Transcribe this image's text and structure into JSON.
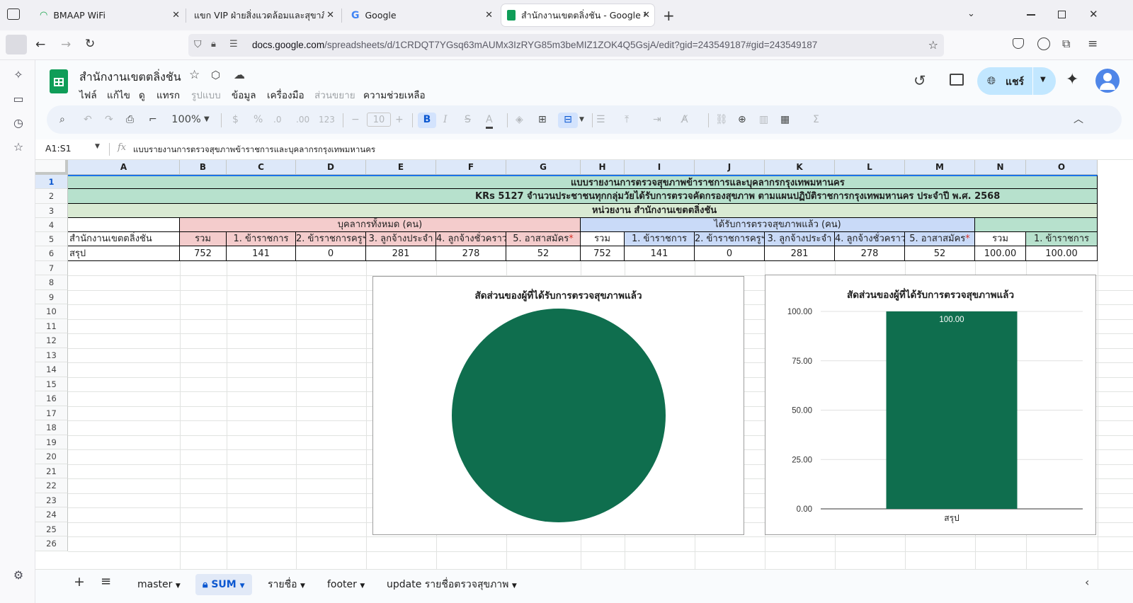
{
  "browser": {
    "tabs": [
      {
        "label": "BMAAP WiFi",
        "icon": "wifi-icon"
      },
      {
        "label": "แขก VIP ฝ่ายสิ่งแวดล้อมและสุขาภิบาล",
        "icon": "none"
      },
      {
        "label": "Google",
        "icon": "google-icon"
      },
      {
        "label": "สำนักงานเขตตลิ่งชัน - Google ชีต",
        "icon": "sheets-icon",
        "active": true
      }
    ],
    "url_domain": "docs.google.com",
    "url_path": "/spreadsheets/d/1CRDQT7YGsq63mAUMx3IzRYG85m3beMIZ1ZOK4Q5GsjA/edit?gid=243549187#gid=243549187"
  },
  "sheets": {
    "title": "สำนักงานเขตตลิ่งชัน",
    "menu": [
      "ไฟล์",
      "แก้ไข",
      "ดู",
      "แทรก",
      "รูปแบบ",
      "ข้อมูล",
      "เครื่องมือ",
      "ส่วนขยาย",
      "ความช่วยเหลือ"
    ],
    "menu_disabled": [
      false,
      false,
      false,
      false,
      true,
      false,
      false,
      true,
      false
    ],
    "share_label": "แชร์",
    "zoom": "100%",
    "font_size": "10",
    "toolbar_text": {
      "currency": "$",
      "percent": "%",
      "dec_minus": ".0",
      "dec_plus": ".00",
      "format123": "123",
      "bold": "B",
      "italic": "I"
    },
    "name_box": "A1:S1",
    "formula": "แบบรายงานการตรวจสุขภาพข้าราชการและบุคลากรกรุงเทพมหานคร"
  },
  "grid": {
    "columns": [
      "A",
      "B",
      "C",
      "D",
      "E",
      "F",
      "G",
      "H",
      "I",
      "J",
      "K",
      "L",
      "M",
      "N",
      "O"
    ],
    "rows": [
      "1",
      "2",
      "3",
      "4",
      "5",
      "6",
      "7",
      "8",
      "9",
      "10",
      "11",
      "12",
      "13",
      "14",
      "15",
      "16",
      "17",
      "18",
      "19",
      "20",
      "21",
      "22",
      "23",
      "24",
      "25",
      "26"
    ],
    "row1": "แบบรายงานการตรวจสุขภาพข้าราชการและบุคลากรกรุงเทพมหานคร",
    "row2": "KRs 5127 จำนวนประชาชนทุกกลุ่มวัยได้รับการตรวจคัดกรองสุขภาพ ตามแผนปฏิบัติราชการกรุงเทพมหานคร ประจำปี พ.ศ. 2568",
    "row3": "หน่วยงาน สำนักงานเขตตลิ่งชัน",
    "group1": "บุคลากรทั้งหมด (คน)",
    "group2": "ได้รับการตรวจสุขภาพแล้ว (คน)",
    "row5": [
      "สำนักงานเขตตลิ่งชัน",
      "รวม",
      "1. ข้าราชการ",
      "2. ข้าราชการครูฯ",
      "3. ลูกจ้างประจำ",
      "4. ลูกจ้างชั่วคราว",
      "5. อาสาสมัคร",
      "รวม",
      "1. ข้าราชการ",
      "2. ข้าราชการครูฯ",
      "3. ลูกจ้างประจำ",
      "4. ลูกจ้างชั่วคราว",
      "5. อาสาสมัคร",
      "รวม",
      "1. ข้าราชการ"
    ],
    "row6": [
      "สรุป",
      "752",
      "141",
      "0",
      "281",
      "278",
      "52",
      "752",
      "141",
      "0",
      "281",
      "278",
      "52",
      "100.00",
      "100.00"
    ]
  },
  "chart_data": [
    {
      "type": "pie",
      "title": "สัดส่วนของผู้ที่ได้รับการตรวจสุขภาพแล้ว",
      "categories": [
        "สรุป"
      ],
      "values": [
        100
      ],
      "colors": [
        "#0f6e4e"
      ]
    },
    {
      "type": "bar",
      "title": "สัดส่วนของผู้ที่ได้รับการตรวจสุขภาพแล้ว",
      "categories": [
        "สรุป"
      ],
      "values": [
        100.0
      ],
      "data_labels": [
        "100.00"
      ],
      "yticks": [
        "0.00",
        "25.00",
        "50.00",
        "75.00",
        "100.00"
      ],
      "ylim": [
        0,
        100
      ],
      "colors": [
        "#0f6e4e"
      ]
    }
  ],
  "sheet_tabs": [
    "master",
    "SUM",
    "รายชื่อ",
    "footer",
    "update รายชื่อตรวจสุขภาพ"
  ],
  "active_sheet": "SUM"
}
